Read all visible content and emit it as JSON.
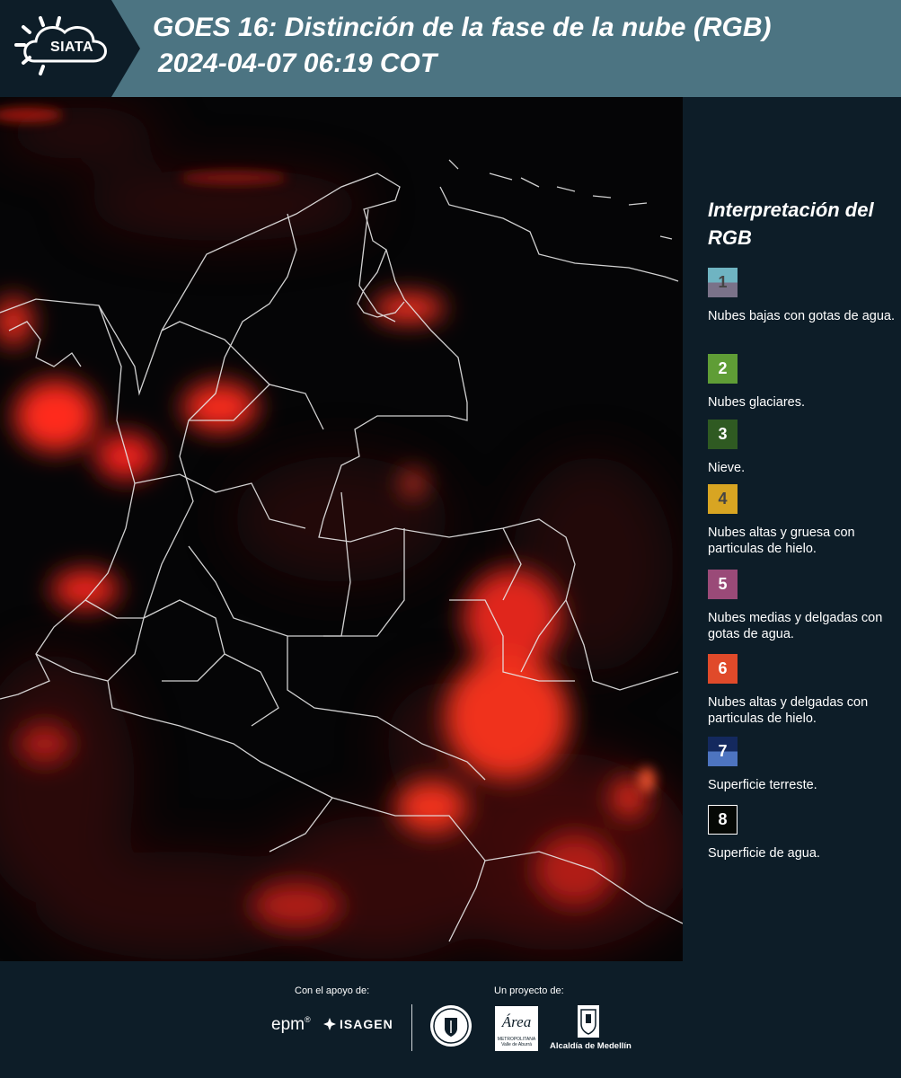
{
  "header": {
    "logo_text": "SIATA",
    "title_line1": "GOES 16: Distinción de la fase de la nube (RGB)",
    "title_line2": "2024-04-07 06:19 COT",
    "bg_color": "#4c7482"
  },
  "legend": {
    "title": "Interpretación del RGB",
    "items": [
      {
        "number": "1",
        "description": "Nubes bajas con gotas de agua.",
        "color_top": "#6fb4c2",
        "color_bottom": "#7a7289",
        "text_color": "#444444"
      },
      {
        "number": "2",
        "description": "Nubes glaciares.",
        "color_top": "#5f9d36",
        "color_bottom": "#5f9d36",
        "text_color": "#ffffff"
      },
      {
        "number": "3",
        "description": "Nieve.",
        "color_top": "#2f5a22",
        "color_bottom": "#2f5a22",
        "text_color": "#ffffff"
      },
      {
        "number": "4",
        "description": "Nubes altas y gruesa con particulas de hielo.",
        "color_top": "#d8a522",
        "color_bottom": "#d8a522",
        "text_color": "#444444"
      },
      {
        "number": "5",
        "description": "Nubes medias y delgadas con gotas de agua.",
        "color_top": "#9a4a78",
        "color_bottom": "#9a4a78",
        "text_color": "#ffffff"
      },
      {
        "number": "6",
        "description": "Nubes altas y delgadas con particulas de hielo.",
        "color_top": "#e04a2a",
        "color_bottom": "#e04a2a",
        "text_color": "#ffffff"
      },
      {
        "number": "7",
        "description": "Superficie terreste.",
        "color_top": "#14295e",
        "color_bottom": "#4d74c0",
        "text_color": "#ffffff"
      },
      {
        "number": "8",
        "description": "Superficie de agua.",
        "color_top": "#050805",
        "color_bottom": "#050805",
        "text_color": "#ffffff"
      }
    ]
  },
  "footer": {
    "support_label": "Con el apoyo de:",
    "project_label": "Un proyecto de:",
    "epm": "epm",
    "isagen": "ISAGEN",
    "area_name": "Área",
    "area_sub1": "METROPOLITANA",
    "area_sub2": "Valle de Aburrá",
    "alcaldia": "Alcaldía de Medellín"
  }
}
